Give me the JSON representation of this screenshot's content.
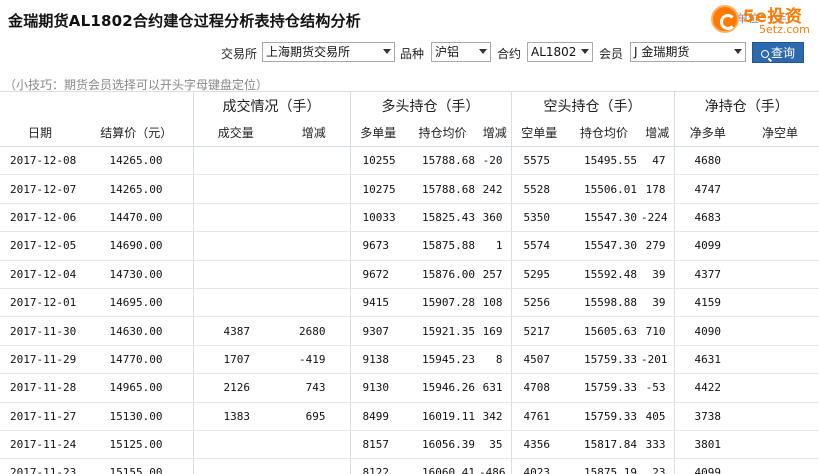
{
  "header": {
    "title": "金瑞期货AL1802合约建仓过程分析表持仓结构分析",
    "unit_note": "单位：（手）",
    "logo": {
      "main": "5e投资",
      "sub": "5etz.com"
    }
  },
  "filters": {
    "exchange_label": "交易所",
    "exchange_value": "上海期货交易所",
    "variety_label": "品种",
    "variety_value": "沪铝",
    "contract_label": "合约",
    "contract_value": "AL1802",
    "member_label": "会员",
    "member_value": "J 金瑞期货",
    "search_label": "查询"
  },
  "tip": "（小技巧：期货会员选择可以开头字母键盘定位）",
  "table": {
    "groups": [
      "成交情况（手）",
      "多头持仓（手）",
      "空头持仓（手）",
      "净持仓（手）"
    ],
    "columns": [
      "日期",
      "结算价（元）",
      "成交量",
      "增减",
      "多单量",
      "持仓均价",
      "增减",
      "空单量",
      "持仓均价",
      "增减",
      "净多单",
      "净空单"
    ],
    "rows": [
      {
        "date": "2017-12-08",
        "settle": "14265.00",
        "vol": "",
        "vol_chg": "",
        "long": "10255",
        "long_avg": "15788.68",
        "long_chg": "-20",
        "short": "5575",
        "short_avg": "15495.55",
        "short_chg": "47",
        "net_long": "4680",
        "net_short": ""
      },
      {
        "date": "2017-12-07",
        "settle": "14265.00",
        "vol": "",
        "vol_chg": "",
        "long": "10275",
        "long_avg": "15788.68",
        "long_chg": "242",
        "short": "5528",
        "short_avg": "15506.01",
        "short_chg": "178",
        "net_long": "4747",
        "net_short": ""
      },
      {
        "date": "2017-12-06",
        "settle": "14470.00",
        "vol": "",
        "vol_chg": "",
        "long": "10033",
        "long_avg": "15825.43",
        "long_chg": "360",
        "short": "5350",
        "short_avg": "15547.30",
        "short_chg": "-224",
        "net_long": "4683",
        "net_short": ""
      },
      {
        "date": "2017-12-05",
        "settle": "14690.00",
        "vol": "",
        "vol_chg": "",
        "long": "9673",
        "long_avg": "15875.88",
        "long_chg": "1",
        "short": "5574",
        "short_avg": "15547.30",
        "short_chg": "279",
        "net_long": "4099",
        "net_short": ""
      },
      {
        "date": "2017-12-04",
        "settle": "14730.00",
        "vol": "",
        "vol_chg": "",
        "long": "9672",
        "long_avg": "15876.00",
        "long_chg": "257",
        "short": "5295",
        "short_avg": "15592.48",
        "short_chg": "39",
        "net_long": "4377",
        "net_short": ""
      },
      {
        "date": "2017-12-01",
        "settle": "14695.00",
        "vol": "",
        "vol_chg": "",
        "long": "9415",
        "long_avg": "15907.28",
        "long_chg": "108",
        "short": "5256",
        "short_avg": "15598.88",
        "short_chg": "39",
        "net_long": "4159",
        "net_short": ""
      },
      {
        "date": "2017-11-30",
        "settle": "14630.00",
        "vol": "4387",
        "vol_chg": "2680",
        "long": "9307",
        "long_avg": "15921.35",
        "long_chg": "169",
        "short": "5217",
        "short_avg": "15605.63",
        "short_chg": "710",
        "net_long": "4090",
        "net_short": ""
      },
      {
        "date": "2017-11-29",
        "settle": "14770.00",
        "vol": "1707",
        "vol_chg": "-419",
        "long": "9138",
        "long_avg": "15945.23",
        "long_chg": "8",
        "short": "4507",
        "short_avg": "15759.33",
        "short_chg": "-201",
        "net_long": "4631",
        "net_short": ""
      },
      {
        "date": "2017-11-28",
        "settle": "14965.00",
        "vol": "2126",
        "vol_chg": "743",
        "long": "9130",
        "long_avg": "15946.26",
        "long_chg": "631",
        "short": "4708",
        "short_avg": "15759.33",
        "short_chg": "-53",
        "net_long": "4422",
        "net_short": ""
      },
      {
        "date": "2017-11-27",
        "settle": "15130.00",
        "vol": "1383",
        "vol_chg": "695",
        "long": "8499",
        "long_avg": "16019.11",
        "long_chg": "342",
        "short": "4761",
        "short_avg": "15759.33",
        "short_chg": "405",
        "net_long": "3738",
        "net_short": ""
      },
      {
        "date": "2017-11-24",
        "settle": "15125.00",
        "vol": "",
        "vol_chg": "",
        "long": "8157",
        "long_avg": "16056.39",
        "long_chg": "35",
        "short": "4356",
        "short_avg": "15817.84",
        "short_chg": "333",
        "net_long": "3801",
        "net_short": ""
      },
      {
        "date": "2017-11-23",
        "settle": "15155.00",
        "vol": "",
        "vol_chg": "",
        "long": "8122",
        "long_avg": "16060.41",
        "long_chg": "-486",
        "short": "4023",
        "short_avg": "15875.19",
        "short_chg": "23",
        "net_long": "4099",
        "net_short": ""
      }
    ]
  },
  "colors": {
    "increase": "#e01b1b",
    "decrease": "#109010",
    "button": "#2d6aad",
    "brand": "#ff7a00"
  }
}
